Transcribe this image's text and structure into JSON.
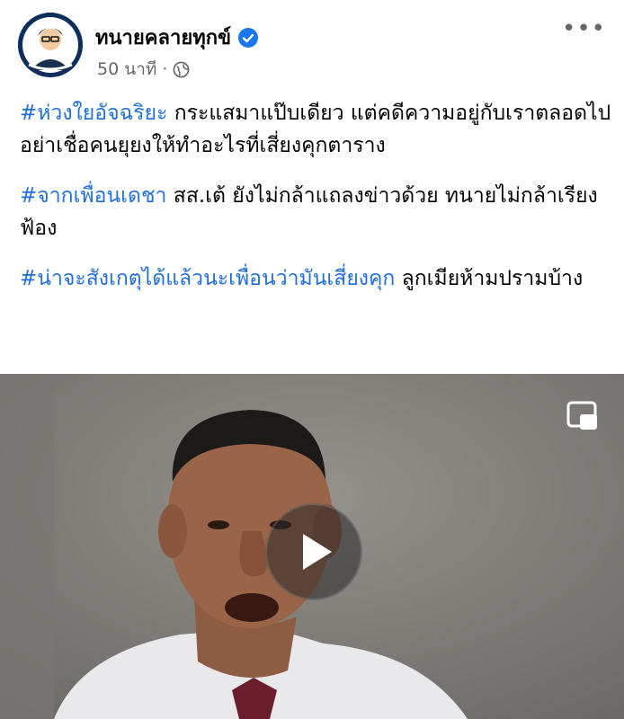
{
  "post": {
    "page_name": "ทนายคลายทุกข์",
    "time": "50 นาที",
    "separator": "·",
    "more": "•••",
    "paragraphs": [
      {
        "tag": "#ห่วงใยอัจฉริยะ",
        "text": " กระแสมาแป๊บเดียว แต่คดีความอยู่กับเราตลอดไป อย่าเชื่อคนยุยงให้ทำอะไรที่เสี่ยงคุกตาราง"
      },
      {
        "tag": "#จากเพื่อนเดชา",
        "text": " สส.เต้ ยังไม่กล้าแถลงข่าวด้วย ทนายไม่กล้าเรียงฟ้อง"
      },
      {
        "tag": "#น่าจะสังเกตุได้แล้วนะเพื่อนว่ามันเสี่ยงคุก",
        "text": " ลูกเมียห้ามปรามบ้าง"
      }
    ]
  },
  "colors": {
    "hashtag": "#216fdb",
    "verified": "#1877f2",
    "meta": "#65676b"
  },
  "icons": [
    "verified-badge-icon",
    "globe-icon",
    "more-options-icon",
    "picture-in-picture-icon",
    "play-icon"
  ]
}
